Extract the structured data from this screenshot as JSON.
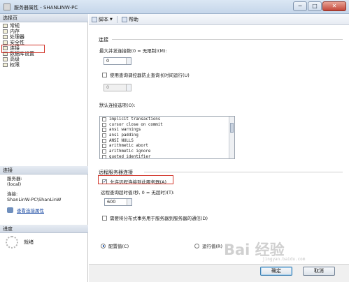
{
  "window": {
    "title": "服务器属性 - SHANLINW-PC",
    "min": "─",
    "max": "□",
    "close": "✕"
  },
  "left": {
    "select_page_header": "选择页",
    "pages": [
      {
        "label": "常规",
        "icon": "page-icon"
      },
      {
        "label": "内存",
        "icon": "page-icon"
      },
      {
        "label": "处理器",
        "icon": "page-icon"
      },
      {
        "label": "安全性",
        "icon": "page-icon"
      },
      {
        "label": "连接",
        "icon": "page-icon",
        "selected": true
      },
      {
        "label": "数据库设置",
        "icon": "page-icon"
      },
      {
        "label": "高级",
        "icon": "page-icon"
      },
      {
        "label": "权限",
        "icon": "page-icon"
      }
    ],
    "connection_header": "连接",
    "server_label": "服务器:",
    "server_value": "(local)",
    "connection_label": "连接:",
    "connection_value": "ShanLinW-PC\\ShanLinW",
    "view_conn_link": "查看连接属性",
    "progress_header": "进度",
    "progress_status": "就绪"
  },
  "toolbar": {
    "script": "脚本",
    "script_arrow": "▼",
    "help": "帮助"
  },
  "connections": {
    "title": "连接",
    "max_concurrent_label": "最大并发连接数(0 = 无限制)(M):",
    "max_concurrent_value": "0",
    "use_governor_label": "使用查询调控器防止查询长时间运行(U)",
    "use_governor_checked": false,
    "governor_value": "0",
    "default_options_label": "默认连接选项(O):",
    "default_options": [
      "implicit transactions",
      "cursor close on commit",
      "ansi warnings",
      "ansi padding",
      "ANSI NULLS",
      "arithmetic abort",
      "arithmetic ignore",
      "quoted identifier"
    ]
  },
  "remote": {
    "title": "远程服务器连接",
    "allow_remote_label": "允许远程连接到此服务器(A)",
    "allow_remote_checked": true,
    "timeout_label": "远程查询超时值(秒, 0 = 无超时)(T):",
    "timeout_value": "600",
    "distributed_label": "需要将分布式事务用于服务器到服务器的通信(D)",
    "distributed_checked": false
  },
  "values": {
    "configured": "配置值(C)",
    "running": "运行值(R)",
    "selected": "configured"
  },
  "buttons": {
    "ok": "确定",
    "cancel": "取消"
  },
  "watermark": {
    "text": "Bai 经验",
    "sub": "jingyan.baidu.com"
  },
  "colors": {
    "highlight_border": "#d2362b",
    "title_bar": "#c5d6ea",
    "link": "#1a4aa3"
  }
}
